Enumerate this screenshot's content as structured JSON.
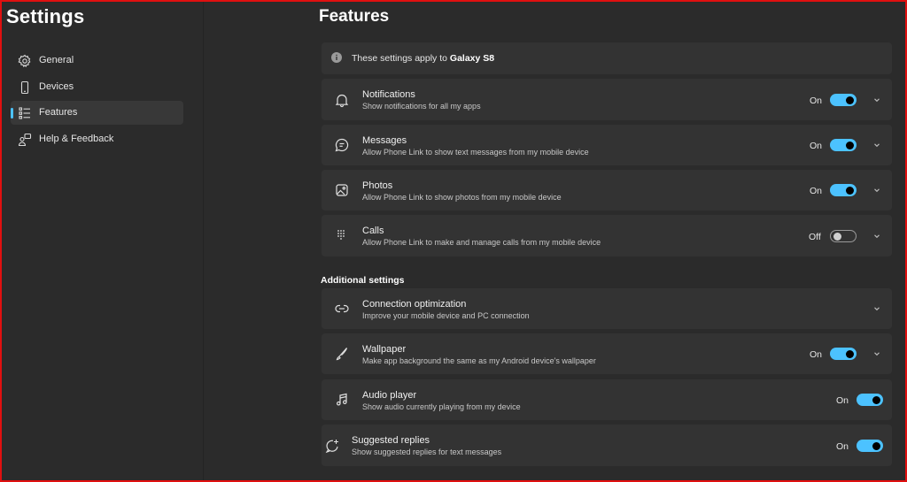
{
  "app": {
    "title": "Settings"
  },
  "sidebar": {
    "items": [
      {
        "label": "General",
        "icon": "gear-icon",
        "active": false
      },
      {
        "label": "Devices",
        "icon": "phone-icon",
        "active": false
      },
      {
        "label": "Features",
        "icon": "list-icon",
        "active": true
      },
      {
        "label": "Help & Feedback",
        "icon": "help-feedback-icon",
        "active": false
      }
    ]
  },
  "main": {
    "title": "Features",
    "info": {
      "prefix": "These settings apply to ",
      "device": "Galaxy S8",
      "icon": "info-icon"
    },
    "features": [
      {
        "title": "Notifications",
        "description": "Show notifications for all my apps",
        "state": "On",
        "enabled": true,
        "expandable": true,
        "icon": "bell-icon"
      },
      {
        "title": "Messages",
        "description": "Allow Phone Link to show text messages from my mobile device",
        "state": "On",
        "enabled": true,
        "expandable": true,
        "icon": "chat-icon"
      },
      {
        "title": "Photos",
        "description": "Allow Phone Link to show photos from my mobile device",
        "state": "On",
        "enabled": true,
        "expandable": true,
        "icon": "photo-icon"
      },
      {
        "title": "Calls",
        "description": "Allow Phone Link to make and manage calls from my mobile device",
        "state": "Off",
        "enabled": false,
        "expandable": true,
        "icon": "dialpad-icon"
      }
    ],
    "additional_header": "Additional settings",
    "additional": [
      {
        "title": "Connection optimization",
        "description": "Improve your mobile device and PC connection",
        "expandable": true,
        "icon": "link-icon"
      },
      {
        "title": "Wallpaper",
        "description": "Make app background the same as my Android device's wallpaper",
        "state": "On",
        "enabled": true,
        "expandable": true,
        "icon": "brush-icon"
      },
      {
        "title": "Audio player",
        "description": "Show audio currently playing from my device",
        "state": "On",
        "enabled": true,
        "expandable": false,
        "icon": "music-icon"
      },
      {
        "title": "Suggested replies",
        "description": "Show suggested replies for text messages",
        "state": "On",
        "enabled": true,
        "expandable": false,
        "icon": "sparkle-chat-icon"
      }
    ]
  },
  "colors": {
    "accent": "#4cc2ff",
    "background": "#2b2b2b",
    "card": "#333333"
  }
}
